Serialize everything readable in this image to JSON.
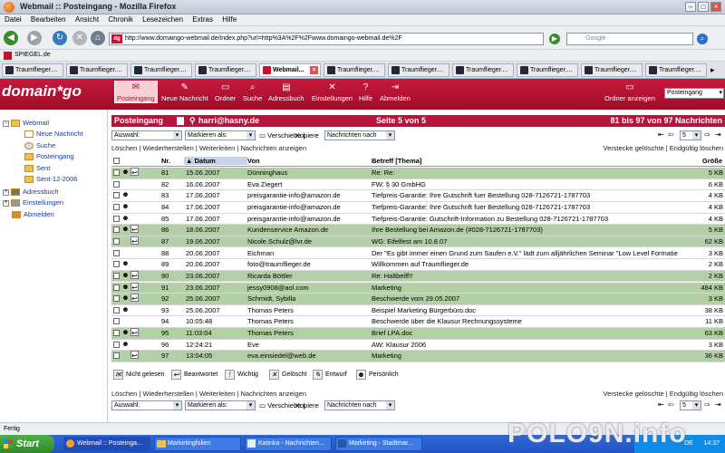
{
  "window": {
    "title": "Webmail :: Posteingang - Mozilla Firefox"
  },
  "menu": [
    "Datei",
    "Bearbeiten",
    "Ansicht",
    "Chronik",
    "Lesezeichen",
    "Extras",
    "Hilfe"
  ],
  "address": {
    "url": "http://www.domaingo-webmail.de/index.php?url=http%3A%2F%2Fwww.domaingo-webmail.de%2F",
    "search_placeholder": "Google",
    "favicon": "dg"
  },
  "bookmarks": {
    "item": "SPIEGEL.de"
  },
  "tabs": [
    {
      "label": "Traumflieger....",
      "active": false
    },
    {
      "label": "Traumflieger....",
      "active": false
    },
    {
      "label": "Traumflieger....",
      "active": false
    },
    {
      "label": "Traumflieger....",
      "active": false
    },
    {
      "label": "Webmail...",
      "active": true
    },
    {
      "label": "Traumflieger....",
      "active": false
    },
    {
      "label": "Traumflieger....",
      "active": false
    },
    {
      "label": "Traumflieger....",
      "active": false
    },
    {
      "label": "Traumflieger....",
      "active": false
    },
    {
      "label": "Traumflieger....",
      "active": false
    },
    {
      "label": "Traumflieger....",
      "active": false
    }
  ],
  "app": {
    "logo": "domain*go",
    "toolbar": [
      {
        "label": "Posteingang",
        "icon": "inbox-icon"
      },
      {
        "label": "Neue Nachricht",
        "icon": "compose-icon"
      },
      {
        "label": "Ordner",
        "icon": "folder-icon"
      },
      {
        "label": "Suche",
        "icon": "search-icon"
      },
      {
        "label": "Adressbuch",
        "icon": "addressbook-icon"
      },
      {
        "label": "Einstellungen",
        "icon": "settings-icon"
      },
      {
        "label": "Hilfe",
        "icon": "help-icon"
      },
      {
        "label": "Abmelden",
        "icon": "logout-icon"
      }
    ],
    "ordner_anzeigen": "Ordner anzeigen",
    "folder_select": "Posteingang"
  },
  "sidebar": [
    {
      "label": "Webmail",
      "indent": 0,
      "toggle": "−"
    },
    {
      "label": "Neue Nachricht",
      "indent": 1
    },
    {
      "label": "Suche",
      "indent": 1
    },
    {
      "label": "Posteingang",
      "indent": 1
    },
    {
      "label": "Sent",
      "indent": 1
    },
    {
      "label": "Sent-12-2006",
      "indent": 1
    },
    {
      "label": "Adressbuch",
      "indent": 0,
      "toggle": "+"
    },
    {
      "label": "Einstellungen",
      "indent": 0,
      "toggle": "+"
    },
    {
      "label": "Abmelden",
      "indent": 0
    }
  ],
  "mailbox": {
    "title": "Posteingang",
    "account": "harri@hasny.de",
    "page": "Seite 5 von 5",
    "range": "81 bis 97 von 97 Nachrichten",
    "select_all": "Auswahl:",
    "mark_as": "Markieren als:",
    "move": "Verschiebe",
    "copy": "Kopiere",
    "msgs_by": "Nachrichten nach",
    "actions": "Löschen | Wiederherstellen | Weiterleiten | Nachrichten anzeigen",
    "hide": "Verstecke gelöschte | Endgültig löschen",
    "page_input": "5"
  },
  "columns": {
    "nr": "Nr.",
    "datum": "▲ Datum",
    "von": "Von",
    "betreff": "Betreff [Thema]",
    "groesse": "Größe"
  },
  "messages": [
    {
      "nr": "81",
      "date": "15.06.2007",
      "from": "Dünninghaus",
      "subject": "Re: Re:",
      "size": "5 KB",
      "green": true,
      "icons": "both"
    },
    {
      "nr": "82",
      "date": "16.06.2007",
      "from": "Eva Ziegert",
      "subject": "FW: § 30 GmbHG",
      "size": "6 KB",
      "green": false,
      "icons": "none"
    },
    {
      "nr": "83",
      "date": "17.06.2007",
      "from": "preisgarantie-info@amazon.de",
      "subject": "Tiefpreis-Garantie: Ihre Gutschrift fuer Bestellung 028-7126721-1787703",
      "size": "4 KB",
      "green": false,
      "icons": "person"
    },
    {
      "nr": "84",
      "date": "17.06.2007",
      "from": "preisgarantie-info@amazon.de",
      "subject": "Tiefpreis-Garantie: Ihre Gutschrift fuer Bestellung 028-7126721-1787703",
      "size": "4 KB",
      "green": false,
      "icons": "person"
    },
    {
      "nr": "85",
      "date": "17.06.2007",
      "from": "preisgarantie-info@amazon.de",
      "subject": "Tiefpreis-Garantie: Gutschrift-Information zu Bestellung 028-7126721-1787703",
      "size": "4 KB",
      "green": false,
      "icons": "person"
    },
    {
      "nr": "86",
      "date": "18.06.2007",
      "from": "Kundenservice Amazon.de",
      "subject": "Ihre Bestellung bei Amazon.de (#028-7126721-1787703)",
      "size": "5 KB",
      "green": true,
      "icons": "both"
    },
    {
      "nr": "87",
      "date": "19.06.2007",
      "from": "Nicole.Schulz@lvr.de",
      "subject": "WG: Eifelfest am 10.8.07",
      "size": "62 KB",
      "green": true,
      "icons": "reply"
    },
    {
      "nr": "88",
      "date": "20.06.2007",
      "from": "Eichman",
      "subject": "Der \"Es gibt immer einen Grund zum Saufen e.V.\" lädt zum alljährlichen Seminar \"Low Level Formatie",
      "size": "3 KB",
      "green": false,
      "icons": "none"
    },
    {
      "nr": "89",
      "date": "20.06.2007",
      "from": "foto@traumflieger.de",
      "subject": "Willkommen auf Traumflieger.de",
      "size": "2 KB",
      "green": false,
      "icons": "person"
    },
    {
      "nr": "90",
      "date": "23.06.2007",
      "from": "Ricarda Böttler",
      "subject": "Re: Haltbeiff!!",
      "size": "2 KB",
      "green": true,
      "icons": "both"
    },
    {
      "nr": "91",
      "date": "23.06.2007",
      "from": "jessy0908@aol.com",
      "subject": "Marketing",
      "size": "484 KB",
      "green": true,
      "icons": "both"
    },
    {
      "nr": "92",
      "date": "25.06.2007",
      "from": "Schmidt, Sybilla",
      "subject": "Beschwerde vom 29.05.2007",
      "size": "3 KB",
      "green": true,
      "icons": "both"
    },
    {
      "nr": "93",
      "date": "25.06.2007",
      "from": "Thomas Peters",
      "subject": "Beispiel Marketing Bürgerbüro.doc",
      "size": "38 KB",
      "green": false,
      "icons": "person"
    },
    {
      "nr": "94",
      "date": "10:05:48",
      "from": "Thomas Peters",
      "subject": "Beschwerde über die Klausur Rechnungssysteme",
      "size": "11 KB",
      "green": false,
      "icons": "none"
    },
    {
      "nr": "95",
      "date": "11:03:04",
      "from": "Thomas Peters",
      "subject": "Brief LPA.doc",
      "size": "63 KB",
      "green": true,
      "icons": "both"
    },
    {
      "nr": "96",
      "date": "12:24:21",
      "from": "Eve",
      "subject": "AW: Klausur 2006",
      "size": "3 KB",
      "green": false,
      "icons": "person"
    },
    {
      "nr": "97",
      "date": "13:04:05",
      "from": "eva.einsiedel@web.de",
      "subject": "Marketing",
      "size": "36 KB",
      "green": true,
      "icons": "reply"
    }
  ],
  "legend": [
    {
      "label": "Nicht gelesen",
      "icon": "unread-icon"
    },
    {
      "label": "Beantwortet",
      "icon": "replied-icon"
    },
    {
      "label": "Wichtig",
      "icon": "important-icon"
    },
    {
      "label": "Gelöscht",
      "icon": "deleted-icon"
    },
    {
      "label": "Entwurf",
      "icon": "draft-icon"
    },
    {
      "label": "Persönlich",
      "icon": "personal-icon"
    }
  ],
  "status": "Fertig",
  "taskbar": {
    "start": "Start",
    "tasks": [
      "Webmail :: Posteinga...",
      "Marketingfolien",
      "Katinka - Nachrichten...",
      "Marketing - Stadtmar..."
    ],
    "lang": "DE",
    "clock": "14:37"
  },
  "watermark": "POLO9N.info"
}
